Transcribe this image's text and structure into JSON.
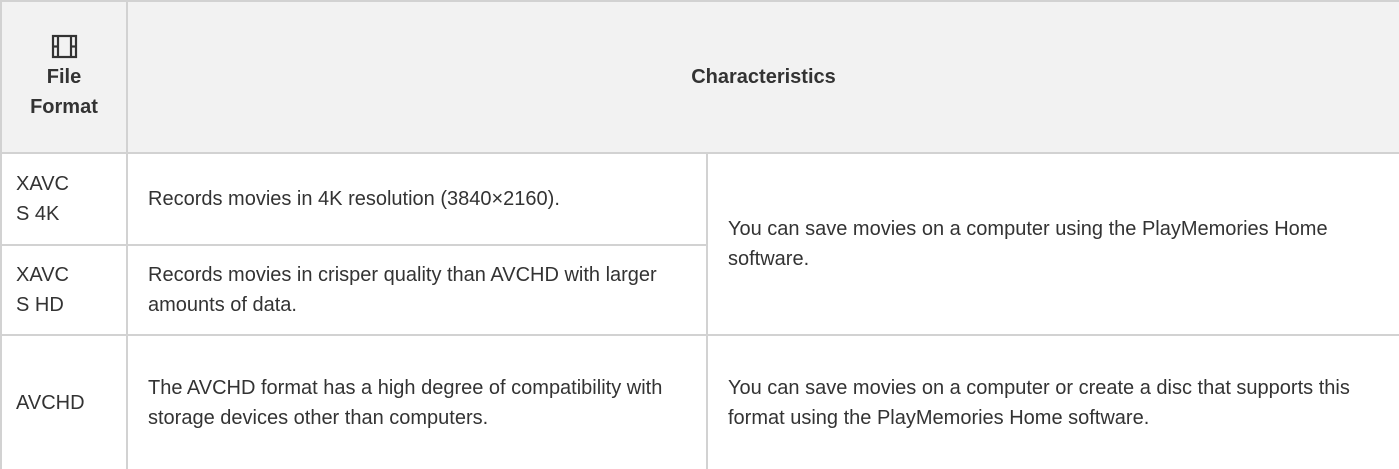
{
  "table": {
    "header": {
      "format_icon": "movie-film-icon",
      "format_label_line1": "File",
      "format_label_line2": "Format",
      "characteristics_label": "Characteristics"
    },
    "rows": [
      {
        "format_line1": "XAVC",
        "format_line2": "S 4K",
        "description": "Records movies in 4K resolution (3840×2160)."
      },
      {
        "format_line1": "XAVC",
        "format_line2": "S HD",
        "description": "Records movies in crisper quality than AVCHD with larger amounts of data."
      },
      {
        "format_line1": "AVCHD",
        "format_line2": "",
        "description": "The AVCHD format has a high degree of compatibility with storage devices other than computers.",
        "saving": "You can save movies on a computer or create a disc that supports this format using the PlayMemories Home software."
      }
    ],
    "shared_saving": "You can save movies on a computer using the PlayMemories Home software."
  }
}
